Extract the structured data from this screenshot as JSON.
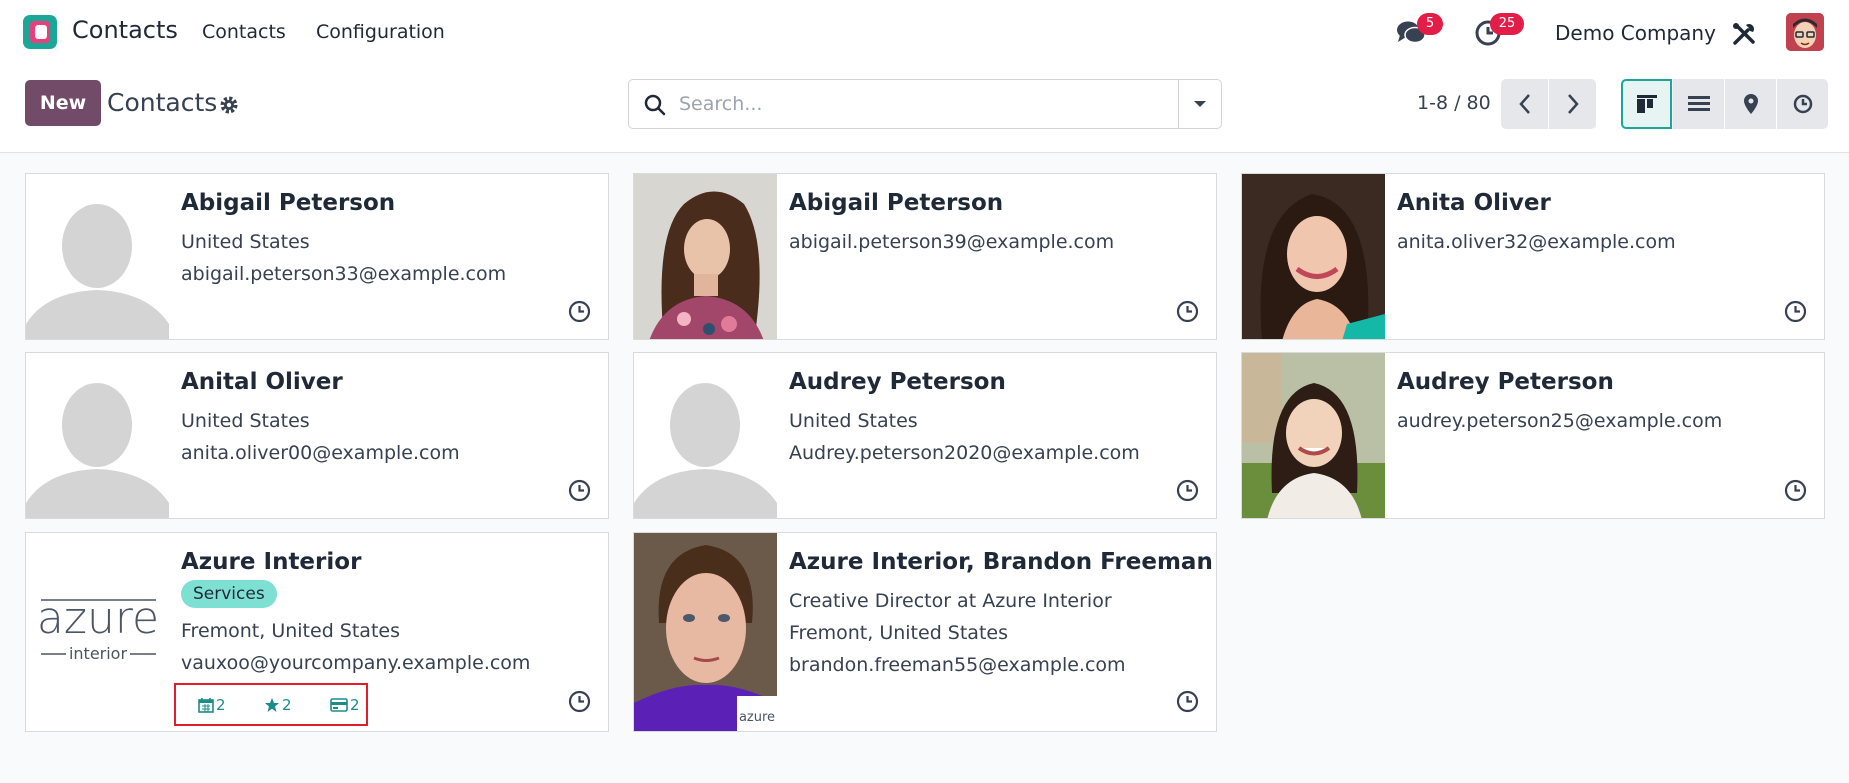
{
  "navbar": {
    "app_name": "Contacts",
    "menu": [
      "Contacts",
      "Configuration"
    ],
    "chat_count": "5",
    "activity_count": "25",
    "company": "Demo Company"
  },
  "control_panel": {
    "new_label": "New",
    "title": "Contacts",
    "search_placeholder": "Search...",
    "pager": "1-8 / 80"
  },
  "cards": [
    {
      "name": "Abigail Peterson",
      "lines": [
        "United States",
        "abigail.peterson33@example.com"
      ],
      "photo": "placeholder"
    },
    {
      "name": "Abigail Peterson",
      "lines": [
        "abigail.peterson39@example.com"
      ],
      "photo": "woman-curly-hair"
    },
    {
      "name": "Anita Oliver",
      "lines": [
        "anita.oliver32@example.com"
      ],
      "photo": "woman-smiling"
    },
    {
      "name": "Anital Oliver",
      "lines": [
        "United States",
        "anita.oliver00@example.com"
      ],
      "photo": "placeholder"
    },
    {
      "name": "Audrey Peterson",
      "lines": [
        "United States",
        "Audrey.peterson2020@example.com"
      ],
      "photo": "placeholder"
    },
    {
      "name": "Audrey Peterson",
      "lines": [
        "audrey.peterson25@example.com"
      ],
      "photo": "woman-outdoor"
    },
    {
      "name": "Azure Interior",
      "tag": "Services",
      "lines": [
        "Fremont, United States",
        "vauxoo@yourcompany.example.com"
      ],
      "photo": "azure-logo",
      "stats": {
        "meetings": "2",
        "opportunities": "2",
        "invoices": "2"
      }
    },
    {
      "name": "Azure Interior, Brandon Freeman",
      "lines": [
        "Creative Director at Azure Interior",
        "Fremont, United States",
        "brandon.freeman55@example.com"
      ],
      "photo": "man-portrait"
    }
  ],
  "logo": {
    "azure_word": "azure",
    "interior_word": "interior"
  },
  "colors": {
    "brand": "#714b67",
    "accent": "#1ba697",
    "badge": "#e11d48",
    "tag": "#7ee0d3",
    "highlight": "#e11d2a"
  }
}
